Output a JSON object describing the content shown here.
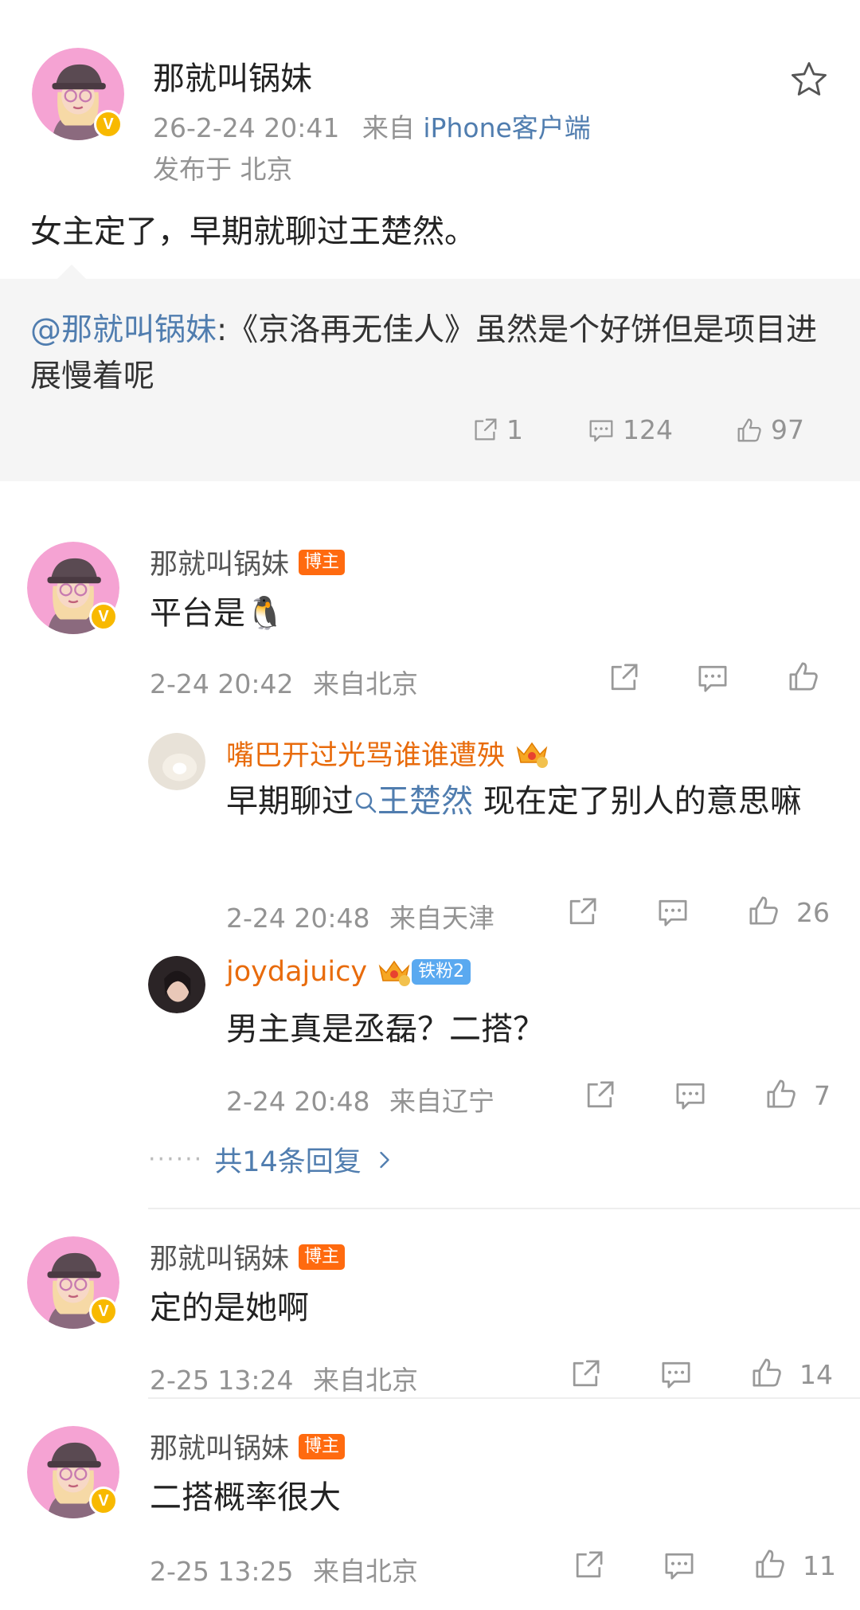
{
  "post": {
    "author": "那就叫锅妹",
    "date": "26-2-24 20:41",
    "source_prefix": "来自",
    "source": "iPhone客户端",
    "location": "发布于 北京",
    "text": "女主定了，早期就聊过王楚然。",
    "repost": {
      "mention": "@那就叫锅妹",
      "text": ":《京洛再无佳人》虽然是个好饼但是项目进展慢着呢",
      "reposts": "1",
      "comments": "124",
      "likes": "97"
    }
  },
  "badges": {
    "blogger": "博主",
    "fan": "铁粉2",
    "verified": "V"
  },
  "comments": [
    {
      "author": "那就叫锅妹",
      "text": "平台是🐧",
      "time": "2-24 20:42",
      "location": "来自北京",
      "likes": ""
    },
    {
      "author": "那就叫锅妹",
      "text": "定的是她啊",
      "time": "2-25 13:24",
      "location": "来自北京",
      "likes": "14"
    },
    {
      "author": "那就叫锅妹",
      "text": "二搭概率很大",
      "time": "2-25 13:25",
      "location": "来自北京",
      "likes": "11"
    }
  ],
  "replies": [
    {
      "author": "嘴巴开过光骂谁谁遭殃",
      "text_before": "早期聊过",
      "topic": "王楚然",
      "text_after": " 现在定了别人的意思嘛",
      "time": "2-24 20:48",
      "location": "来自天津",
      "likes": "26"
    },
    {
      "author": "joydajuicy",
      "text": "男主真是丞磊？二搭？",
      "time": "2-24 20:48",
      "location": "来自辽宁",
      "likes": "7"
    }
  ],
  "more_replies": "共14条回复",
  "colors": {
    "link": "#507daf",
    "meta": "#939393",
    "orange_name": "#e86b0c",
    "blogger_tag": "#ff6a0f",
    "verified": "#f8b900"
  }
}
